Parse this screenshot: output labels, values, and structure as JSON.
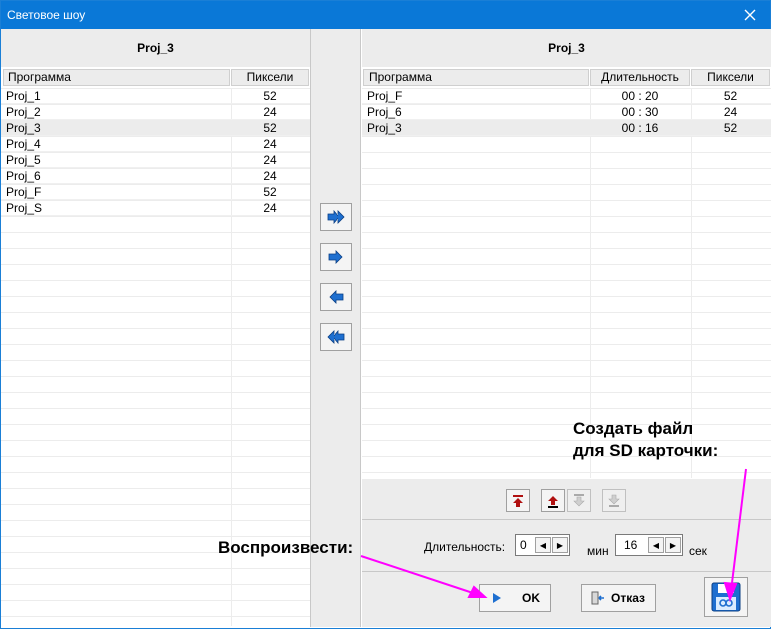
{
  "window": {
    "title": "Световое шоу"
  },
  "left": {
    "header": "Proj_3",
    "col_program": "Программа",
    "col_pixels": "Пиксели",
    "rows": [
      {
        "name": "Proj_1",
        "pixels": "52"
      },
      {
        "name": "Proj_2",
        "pixels": "24"
      },
      {
        "name": "Proj_3",
        "pixels": "52"
      },
      {
        "name": "Proj_4",
        "pixels": "24"
      },
      {
        "name": "Proj_5",
        "pixels": "24"
      },
      {
        "name": "Proj_6",
        "pixels": "24"
      },
      {
        "name": "Proj_F",
        "pixels": "52"
      },
      {
        "name": "Proj_S",
        "pixels": "24"
      }
    ]
  },
  "right": {
    "header": "Proj_3",
    "col_program": "Программа",
    "col_duration": "Длительность",
    "col_pixels": "Пиксели",
    "rows": [
      {
        "name": "Proj_F",
        "duration": "00 : 20",
        "pixels": "52"
      },
      {
        "name": "Proj_6",
        "duration": "00 : 30",
        "pixels": "24"
      },
      {
        "name": "Proj_3",
        "duration": "00 : 16",
        "pixels": "52"
      }
    ]
  },
  "icons": {
    "move_all_right": "double-arrow-right-icon",
    "move_right": "arrow-right-icon",
    "move_left": "arrow-left-icon",
    "move_all_left": "double-arrow-left-icon"
  },
  "duration": {
    "label": "Длительность:",
    "minutes": "0",
    "min_unit": "мин",
    "seconds": "16",
    "sec_unit": "сек"
  },
  "buttons": {
    "ok": "OK",
    "cancel": "Отказ"
  },
  "annotations": {
    "play": "Воспроизвести:",
    "sd_line1": "Создать файл",
    "sd_line2": "для SD карточки:"
  },
  "colors": {
    "titlebar": "#0a78d7",
    "arrow_blue": "#1e6fd0",
    "annotation_arrow": "#ff00ff"
  }
}
